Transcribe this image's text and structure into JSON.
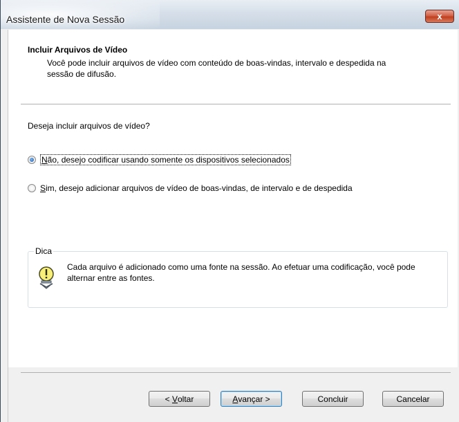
{
  "window": {
    "title": "Assistente de Nova Sessão",
    "close_glyph": "x"
  },
  "header": {
    "title": "Incluir Arquivos de Vídeo",
    "description": "Você pode incluir arquivos de vídeo com conteúdo de boas-vindas, intervalo e despedida na sessão de difusão."
  },
  "question": "Deseja incluir arquivos de vídeo?",
  "options": [
    {
      "mnemonic": "N",
      "rest": "ão, desejo codificar usando somente os dispositivos selecionados",
      "checked": true
    },
    {
      "mnemonic": "S",
      "rest": "im, desejo adicionar arquivos de vídeo de boas-vindas, de intervalo e de despedida",
      "checked": false
    }
  ],
  "tip": {
    "legend": "Dica",
    "text": "Cada arquivo é adicionado como uma fonte na sessão. Ao efetuar uma codificação, você pode alternar entre as fontes.",
    "icon": "lightbulb-icon"
  },
  "buttons": {
    "back": {
      "prefix": "< ",
      "mnemonic": "V",
      "rest": "oltar"
    },
    "next": {
      "prefix": "",
      "mnemonic": "A",
      "rest": "vançar >"
    },
    "finish": "Concluir",
    "cancel": "Cancelar"
  },
  "colors": {
    "close_button": "#c7442a",
    "radio_checked": "#1d5aa8",
    "default_button_border": "#3c7fb1"
  }
}
